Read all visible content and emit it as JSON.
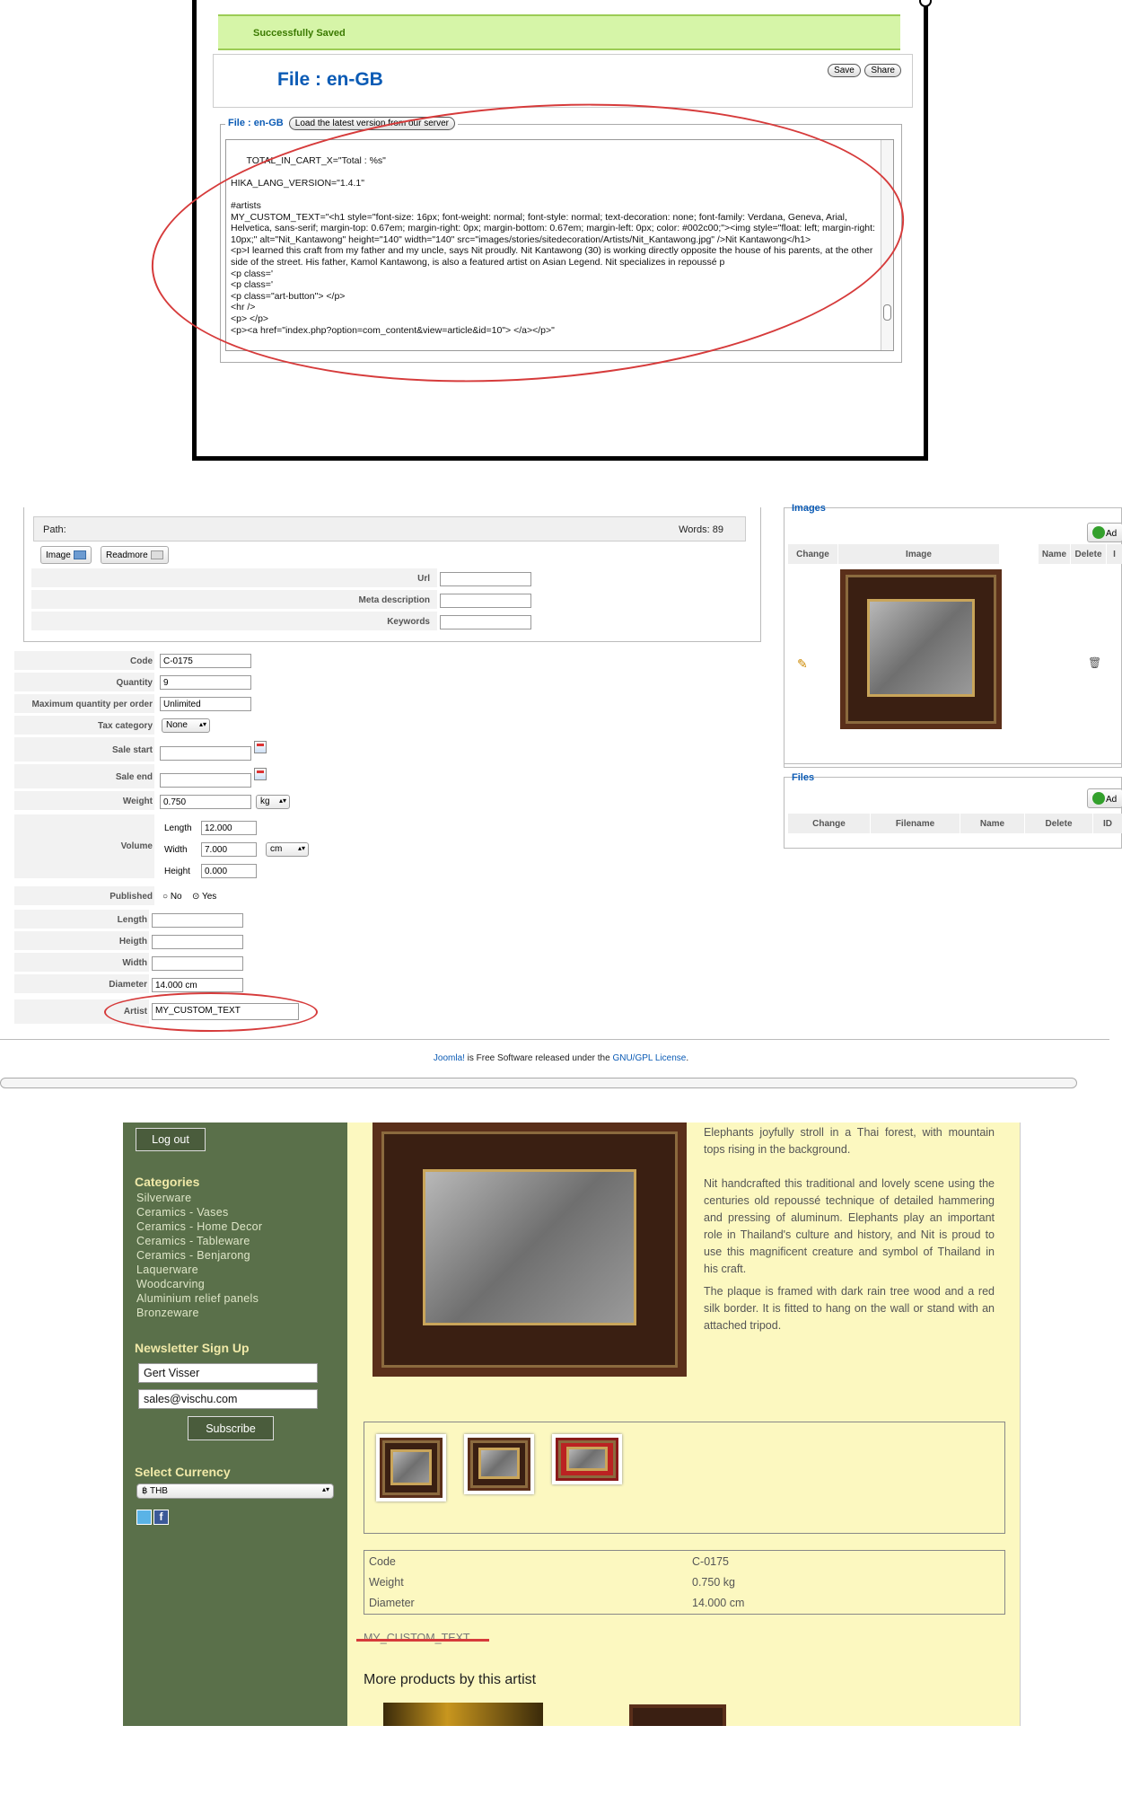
{
  "panel1": {
    "success_msg": "Successfully Saved",
    "file_title": "File : en-GB",
    "save_label": "Save",
    "share_label": "Share",
    "legend": "File : en-GB",
    "load_label": "Load the latest version from our server",
    "code_text": "TOTAL_IN_CART_X=\"Total : %s\"\n\nHIKA_LANG_VERSION=\"1.4.1\"\n\n#artists\nMY_CUSTOM_TEXT=\"<h1 style=\"font-size: 16px; font-weight: normal; font-style: normal; text-decoration: none; font-family: Verdana, Geneva, Arial, Helvetica, sans-serif; margin-top: 0.67em; margin-right: 0px; margin-bottom: 0.67em; margin-left: 0px; color: #002c00;\"><img style=\"float: left; margin-right: 10px;\" alt=\"Nit_Kantawong\" height=\"140\" width=\"140\" src=\"images/stories/sitedecoration/Artists/Nit_Kantawong.jpg\" />Nit Kantawong</h1>\n<p>I learned this craft from my father and my uncle, says Nit proudly. Nit Kantawong (30) is working directly opposite the house of his parents, at the other side of the street. His father, Kamol Kantawong, is also a featured artist on Asian Legend. Nit specializes in repoussé p\n<p class='\n<p class='\n<p class=\"art-button\"> </p>\n<hr />\n<p> </p>\n<p><a href=\"index.php?option=com_content&view=article&id=10\"> </a></p>\""
  },
  "panel2": {
    "path_label": "Path:",
    "words_label": "Words: 89",
    "image_btn": "Image",
    "readmore_btn": "Readmore",
    "url_label": "Url",
    "meta_label": "Meta description",
    "keywords_label": "Keywords",
    "code_label": "Code",
    "code_value": "C-0175",
    "quantity_label": "Quantity",
    "quantity_value": "9",
    "maxq_label": "Maximum quantity per order",
    "maxq_value": "Unlimited",
    "tax_label": "Tax category",
    "tax_value": "None",
    "salestart_label": "Sale start",
    "saleend_label": "Sale end",
    "weight_label": "Weight",
    "weight_value": "0.750",
    "weight_unit": "kg",
    "volume_label": "Volume",
    "length_label": "Length",
    "length_value": "12.000",
    "width_label": "Width",
    "width_value": "7.000",
    "vol_unit": "cm",
    "height_label": "Height",
    "height_value": "0.000",
    "published_label": "Published",
    "no_label": "No",
    "yes_label": "Yes",
    "length2_label": "Length",
    "heigth2_label": "Heigth",
    "width2_label": "Width",
    "diameter_label": "Diameter",
    "diameter_value": "14.000 cm",
    "artist_label": "Artist",
    "artist_value": "MY_CUSTOM_TEXT",
    "images_legend": "Images",
    "add_label": "Ad",
    "img_headers": [
      "Change",
      "Image",
      "Name",
      "Delete",
      "I"
    ],
    "files_legend": "Files",
    "file_headers": [
      "Change",
      "Filename",
      "Name",
      "Delete",
      "ID"
    ],
    "footer_link1": "Joomla!",
    "footer_text": " is Free Software released under the ",
    "footer_link2": "GNU/GPL License",
    "footer_end": "."
  },
  "panel3": {
    "logout": "Log out",
    "categories_h": "Categories",
    "categories": [
      "Silverware",
      "Ceramics - Vases",
      "Ceramics - Home Decor",
      "Ceramics - Tableware",
      "Ceramics - Benjarong",
      "Laquerware",
      "Woodcarving",
      "Aluminium relief panels",
      "Bronzeware"
    ],
    "newsletter_h": "Newsletter Sign Up",
    "name_value": "Gert Visser",
    "email_value": "sales@vischu.com",
    "subscribe": "Subscribe",
    "currency_h": "Select Currency",
    "currency_value": "฿ THB",
    "desc_p1": "Elephants joyfully stroll in a Thai forest, with mountain tops rising in the background.",
    "desc_p2": "Nit handcrafted this traditional and lovely scene using the centuries old repoussé technique of detailed hammering and pressing of aluminum. Elephants play an important role in Thailand's culture and history, and Nit is proud to use this magnificent creature and symbol of Thailand in his craft.",
    "desc_p3": "The plaque is framed with dark rain tree wood and a red silk border. It is fitted to hang on the wall or stand with an attached tripod.",
    "info": [
      {
        "k": "Code",
        "v": "C-0175"
      },
      {
        "k": "Weight",
        "v": "0.750 kg"
      },
      {
        "k": "Diameter",
        "v": "14.000 cm"
      }
    ],
    "custom_text": "MY_CUSTOM_TEXT",
    "more_products": "More products by this artist"
  },
  "colors": {
    "success_bg": "#d6f5a8",
    "link_blue": "#0b5bb5",
    "annotation_red": "#d63b3b",
    "sidebar_green": "#5a704a",
    "content_yellow": "#fcf8c0"
  }
}
